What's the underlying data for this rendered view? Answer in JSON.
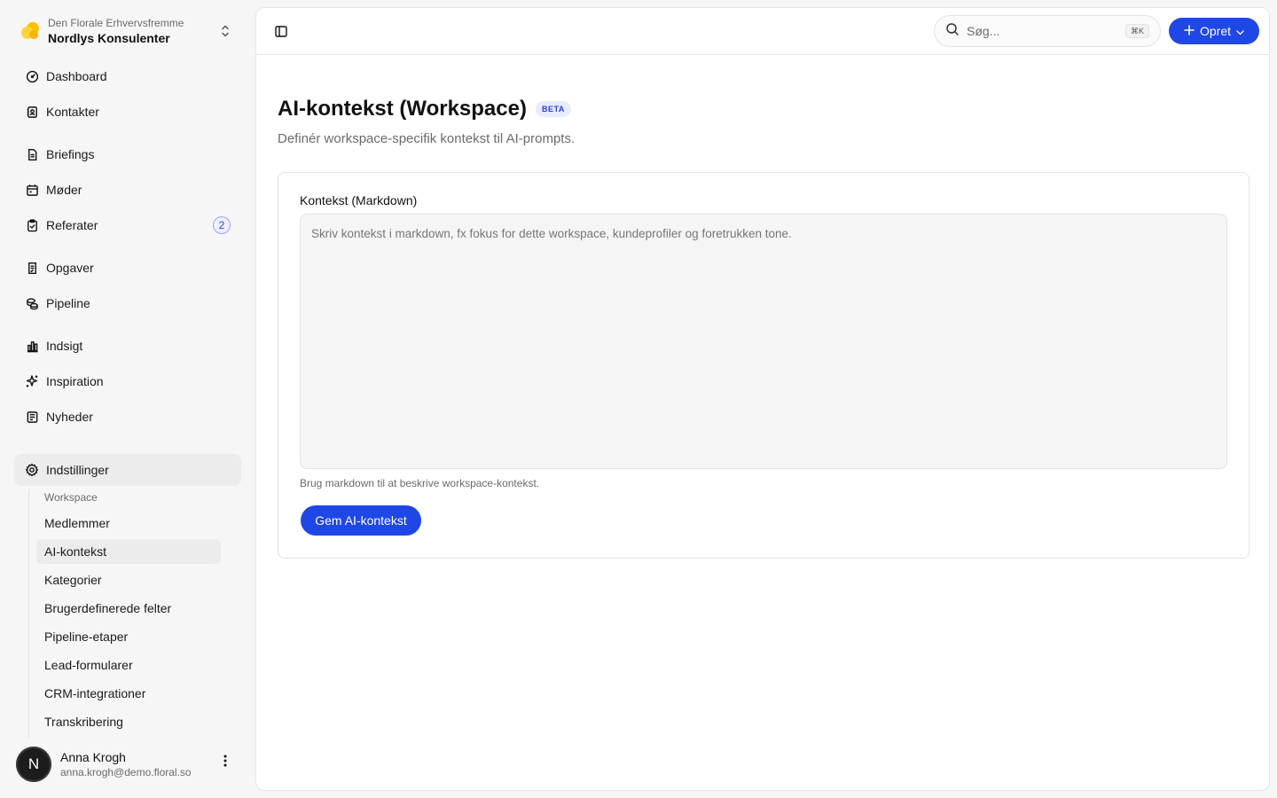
{
  "workspace": {
    "org": "Den Florale Erhvervsfremme",
    "name": "Nordlys Konsulenter"
  },
  "nav": {
    "dashboard": "Dashboard",
    "kontakter": "Kontakter",
    "briefings": "Briefings",
    "moder": "Møder",
    "referater": "Referater",
    "referater_badge": "2",
    "opgaver": "Opgaver",
    "pipeline": "Pipeline",
    "indsigt": "Indsigt",
    "inspiration": "Inspiration",
    "nyheder": "Nyheder",
    "indstillinger": "Indstillinger"
  },
  "settings_sub": {
    "group": "Workspace",
    "items": [
      "Medlemmer",
      "AI-kontekst",
      "Kategorier",
      "Brugerdefinerede felter",
      "Pipeline-etaper",
      "Lead-formularer",
      "CRM-integrationer",
      "Transkribering"
    ]
  },
  "user": {
    "initial": "N",
    "name": "Anna Krogh",
    "email": "anna.krogh@demo.floral.so"
  },
  "topbar": {
    "search_placeholder": "Søg...",
    "search_shortcut": "⌘K",
    "create_label": "Opret"
  },
  "page": {
    "title": "AI-kontekst (Workspace)",
    "badge": "BETA",
    "subtitle": "Definér workspace-specifik kontekst til AI-prompts."
  },
  "form": {
    "label": "Kontekst (Markdown)",
    "value": "",
    "placeholder": "Skriv kontekst i markdown, fx fokus for dette workspace, kundeprofiler og foretrukken tone.",
    "help": "Brug markdown til at beskrive workspace-kontekst.",
    "save_label": "Gem AI-kontekst"
  },
  "colors": {
    "accent": "#1f47e6",
    "sidebar_bg": "#f6f6f6",
    "badge_bg": "#e8ecff"
  }
}
